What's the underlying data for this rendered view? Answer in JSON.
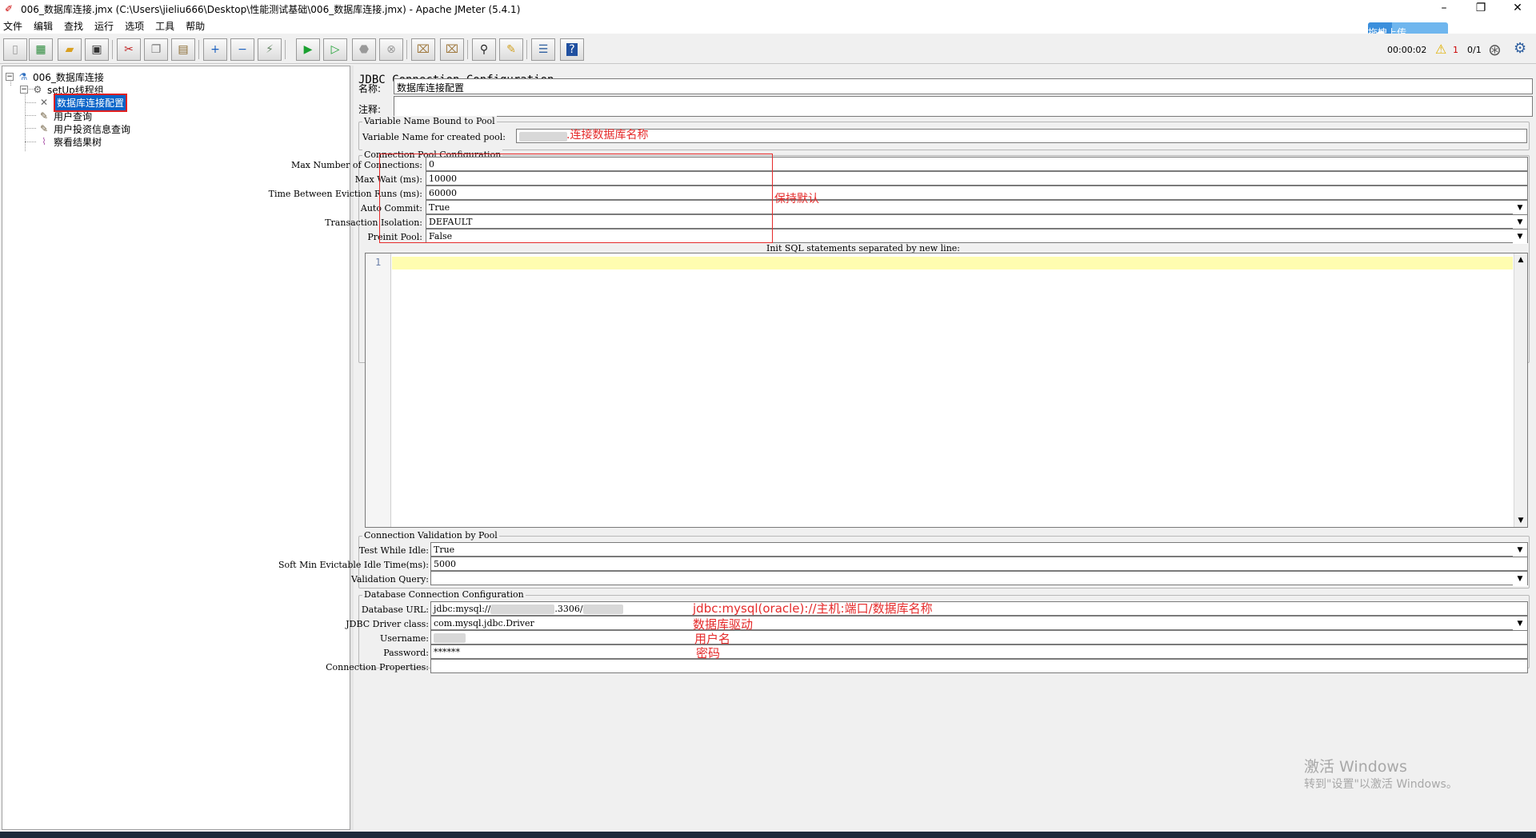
{
  "window": {
    "title": "006_数据库连接.jmx (C:\\Users\\jieliu666\\Desktop\\性能测试基础\\006_数据库连接.jmx) - Apache JMeter (5.4.1)",
    "minimize": "–",
    "maximize": "❐",
    "close": "✕"
  },
  "menu": [
    "文件",
    "编辑",
    "查找",
    "运行",
    "选项",
    "工具",
    "帮助"
  ],
  "upload_button": "拖拽上传",
  "status": {
    "elapsed": "00:00:02",
    "warnings": "1",
    "threads": "0/1"
  },
  "toolbar_icons": [
    "new-icon",
    "templates-icon",
    "open-icon",
    "save-icon",
    "cut-icon",
    "copy-icon",
    "paste-icon",
    "expand-icon",
    "collapse-icon",
    "toggle-icon",
    "start-icon",
    "start-no-timers-icon",
    "stop-icon",
    "shutdown-icon",
    "clear-icon",
    "clear-all-icon",
    "search-icon",
    "reset-search-icon",
    "function-helper-icon",
    "help-icon"
  ],
  "tree": {
    "root": "006_数据库连接",
    "thread_group": "setUp线程组",
    "items": [
      "数据库连接配置",
      "用户查询",
      "用户投资信息查询",
      "察看结果树"
    ]
  },
  "panel": {
    "heading": "JDBC Connection Configuration",
    "name_label": "名称:",
    "name_value": "数据库连接配置",
    "comment_label": "注释:",
    "comment_value": ""
  },
  "variable_group": {
    "title": "Variable Name Bound to Pool",
    "label": "Variable Name for created pool:",
    "annotation": ".连接数据库名称"
  },
  "pool_group": {
    "title": "Connection Pool Configuration",
    "rows": [
      {
        "label": "Max Number of Connections:",
        "value": "0"
      },
      {
        "label": "Max Wait (ms):",
        "value": "10000"
      },
      {
        "label": "Time Between Eviction Runs (ms):",
        "value": "60000"
      },
      {
        "label": "Auto Commit:",
        "value": "True"
      },
      {
        "label": "Transaction Isolation:",
        "value": "DEFAULT"
      },
      {
        "label": "Preinit Pool:",
        "value": "False"
      }
    ],
    "annotation": "保持默认"
  },
  "init_sql": {
    "label": "Init SQL statements separated by new line:",
    "line_number": "1"
  },
  "validation_group": {
    "title": "Connection Validation by Pool",
    "rows": [
      {
        "label": "Test While Idle:",
        "value": "True"
      },
      {
        "label": "Soft Min Evictable Idle Time(ms):",
        "value": "5000"
      },
      {
        "label": "Validation Query:",
        "value": ""
      }
    ]
  },
  "db_group": {
    "title": "Database Connection Configuration",
    "rows": [
      {
        "label": "Database URL:",
        "value_prefix": "jdbc:mysql://",
        "value_mid": ".3306/",
        "annotation": "jdbc:mysql(oracle)://主机:端口/数据库名称"
      },
      {
        "label": "JDBC Driver class:",
        "value": "com.mysql.jdbc.Driver",
        "annotation": "数据库驱动"
      },
      {
        "label": "Username:",
        "value": "",
        "annotation": "用户名"
      },
      {
        "label": "Password:",
        "value": "******",
        "annotation": "密码"
      },
      {
        "label": "Connection Properties:",
        "value": ""
      }
    ]
  },
  "watermark": {
    "line1": "激活 Windows",
    "line2": "转到\"设置\"以激活 Windows。"
  },
  "colors": {
    "selection": "#0a64c8",
    "annotation_red": "#e52b2b",
    "current_line": "#fffdb0"
  }
}
